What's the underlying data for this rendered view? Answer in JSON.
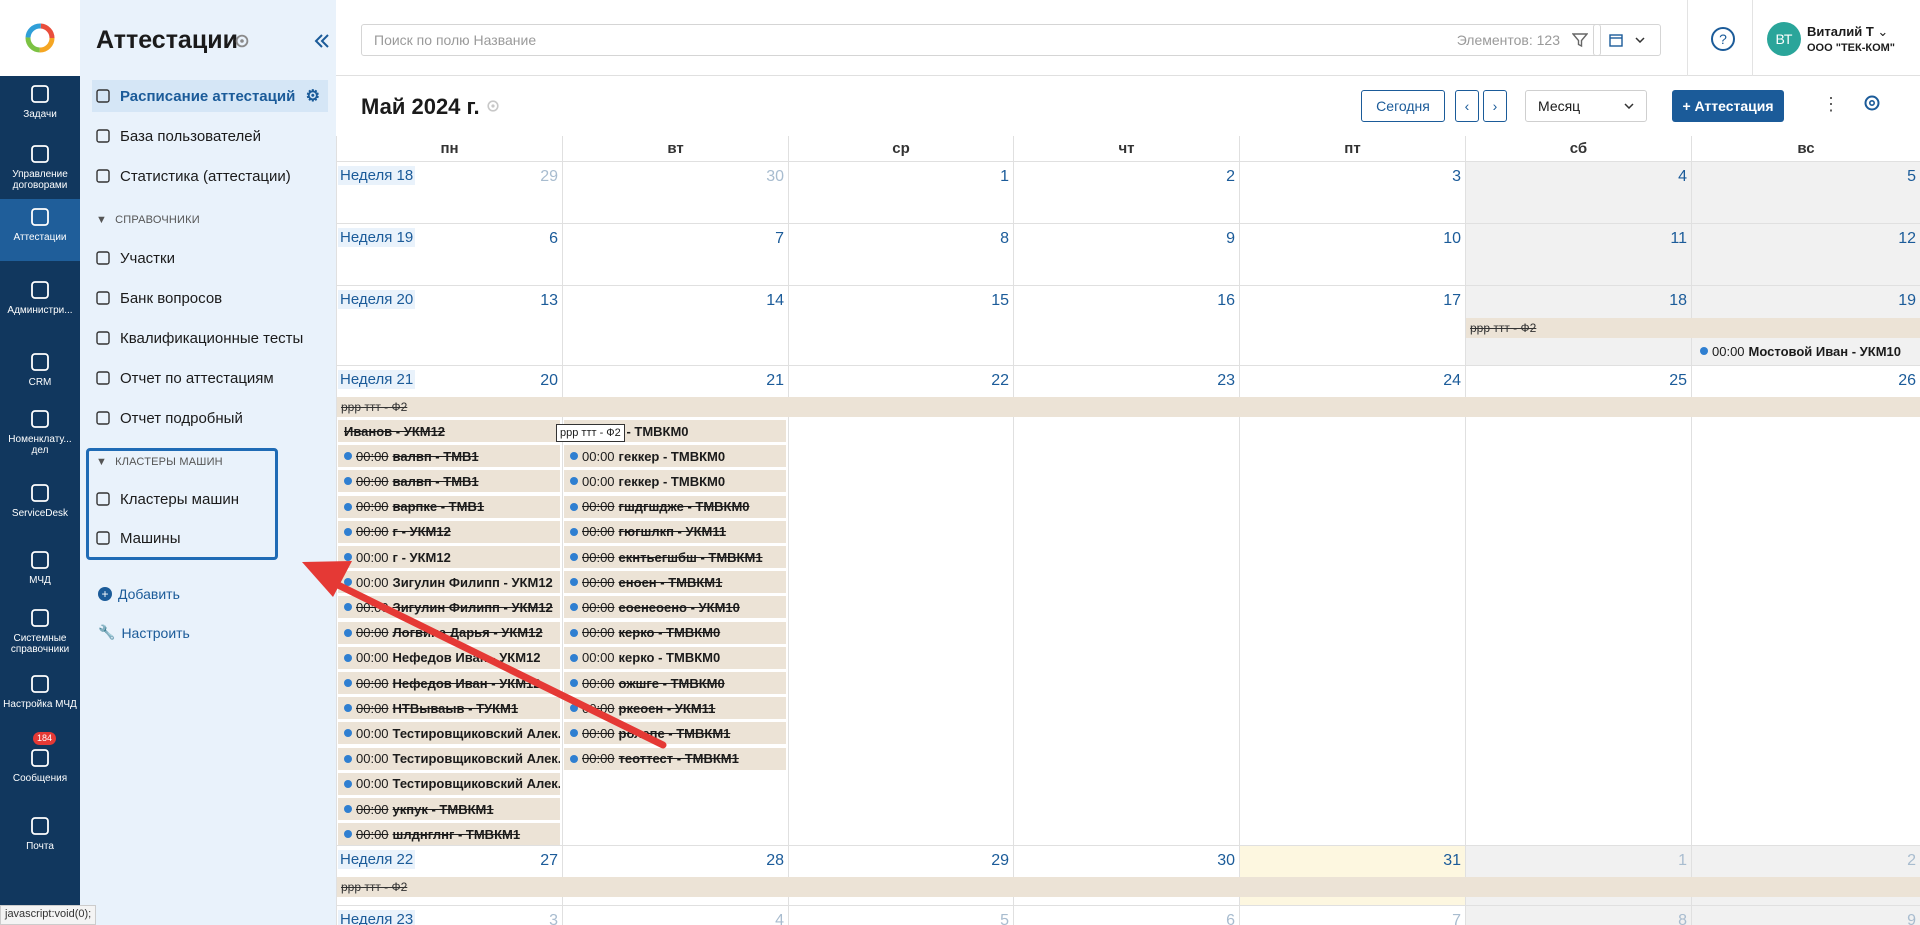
{
  "rail": {
    "items": [
      {
        "label": "Задачи",
        "icon": "arrow-up-icon"
      },
      {
        "label": "Управление договорами",
        "icon": "briefcase-icon"
      },
      {
        "label": "Аттестации",
        "icon": "graduation-cap-icon"
      },
      {
        "label": "Администри...",
        "icon": "gear-icon"
      },
      {
        "label": "CRM",
        "icon": "crm-icon"
      },
      {
        "label": "Номенклату... дел",
        "icon": "book-icon"
      },
      {
        "label": "ServiceDesk",
        "icon": "support-agent-icon"
      },
      {
        "label": "МЧД",
        "icon": "archive-box-icon"
      },
      {
        "label": "Системные справочники",
        "icon": "book-icon"
      },
      {
        "label": "Настройка МЧД",
        "icon": "gear-icon"
      },
      {
        "label": "Сообщения",
        "icon": "envelope-icon",
        "badge": "184"
      },
      {
        "label": "Почта",
        "icon": "at-icon"
      }
    ]
  },
  "sidebar": {
    "title": "Аттестации",
    "items": [
      {
        "label": "Расписание аттестаций",
        "icon": "graduation-cap-icon"
      },
      {
        "label": "База пользователей",
        "icon": "user-icon"
      },
      {
        "label": "Статистика (аттестации)",
        "icon": "bar-chart-icon"
      }
    ],
    "section1": "СПРАВОЧНИКИ",
    "refs": [
      {
        "label": "Участки",
        "icon": "area-icon"
      },
      {
        "label": "Банк вопросов",
        "icon": "clipboard-icon"
      },
      {
        "label": "Квалификационные тесты",
        "icon": "checklist-icon"
      },
      {
        "label": "Отчет по аттестациям",
        "icon": "report-icon"
      },
      {
        "label": "Отчет подробный",
        "icon": "cloud-icon"
      }
    ],
    "section2": "КЛАСТЕРЫ МАШИН",
    "clusters": [
      {
        "label": "Кластеры машин",
        "icon": "database-icon"
      },
      {
        "label": "Машины",
        "icon": "machine-icon"
      }
    ],
    "add_label": "Добавить",
    "configure_label": "Настроить"
  },
  "topbar": {
    "search_placeholder": "Поиск по полю Название",
    "count_label": "Элементов: 123",
    "user_initials": "ВТ",
    "user_name": "Виталий Т",
    "user_org": "ООО \"ТЕК-КОМ\""
  },
  "calendar": {
    "month_title": "Май 2024 г.",
    "today_label": "Сегодня",
    "view_label": "Месяц",
    "add_label": "+ Аттестация",
    "day_names": [
      "пн",
      "вт",
      "ср",
      "чт",
      "пт",
      "сб",
      "вс"
    ],
    "weeks": [
      {
        "label": "Неделя 18",
        "days": [
          "29",
          "30",
          "1",
          "2",
          "3",
          "4",
          "5"
        ]
      },
      {
        "label": "Неделя 19",
        "days": [
          "6",
          "7",
          "8",
          "9",
          "10",
          "11",
          "12"
        ]
      },
      {
        "label": "Неделя 20",
        "days": [
          "13",
          "14",
          "15",
          "16",
          "17",
          "18",
          "19"
        ]
      },
      {
        "label": "Неделя 21",
        "days": [
          "20",
          "21",
          "22",
          "23",
          "24",
          "25",
          "26"
        ]
      },
      {
        "label": "Неделя 22",
        "days": [
          "27",
          "28",
          "29",
          "30",
          "31",
          "1",
          "2"
        ]
      },
      {
        "label": "Неделя 23",
        "days": [
          "3",
          "4",
          "5",
          "6",
          "7",
          "8",
          "9"
        ]
      }
    ],
    "span_event": "ррр ттт - Ф2",
    "week20_sun_event": {
      "time": "00:00",
      "name": "Мостовой Иван - УКМ10"
    },
    "mon_events": [
      {
        "time": "",
        "name": "Иванов - УКМ12",
        "struck": true,
        "dot": false
      },
      {
        "time": "00:00",
        "name": "валвп - ТМВ1",
        "struck": true
      },
      {
        "time": "00:00",
        "name": "валвп - ТМВ1",
        "struck": true
      },
      {
        "time": "00:00",
        "name": "варпке - ТМВ1",
        "struck": true
      },
      {
        "time": "00:00",
        "name": "г - УКМ12",
        "struck": true
      },
      {
        "time": "00:00",
        "name": "г - УКМ12",
        "struck": false
      },
      {
        "time": "00:00",
        "name": "Зигулин Филипп - УКМ12",
        "struck": false
      },
      {
        "time": "00:00",
        "name": "Зигулин Филипп - УКМ12",
        "struck": true
      },
      {
        "time": "00:00",
        "name": "Логвина Дарья - УКМ12",
        "struck": true
      },
      {
        "time": "00:00",
        "name": "Нефедов Иван - УКМ12",
        "struck": false
      },
      {
        "time": "00:00",
        "name": "Нефедов Иван - УКМ12",
        "struck": true
      },
      {
        "time": "00:00",
        "name": "НТВываыв - ТУКМ1",
        "struck": true
      },
      {
        "time": "00:00",
        "name": "Тестировщиковский Алек...",
        "struck": false
      },
      {
        "time": "00:00",
        "name": "Тестировщиковский Алек...",
        "struck": false
      },
      {
        "time": "00:00",
        "name": "Тестировщиковский Алек...",
        "struck": false
      },
      {
        "time": "00:00",
        "name": "укпук - ТМВКМ1",
        "struck": true
      },
      {
        "time": "00:00",
        "name": "шлднглнг - ТМВКМ1",
        "struck": true
      }
    ],
    "tue_events": [
      {
        "time": "",
        "name": "геккер - ТМВКМ0",
        "struck": false
      },
      {
        "time": "00:00",
        "name": "геккер - ТМВКМ0",
        "struck": false
      },
      {
        "time": "00:00",
        "name": "геккер - ТМВКМ0",
        "struck": false
      },
      {
        "time": "00:00",
        "name": "гшдгшдже - ТМВКМ0",
        "struck": true
      },
      {
        "time": "00:00",
        "name": "гюгшлкп - УКМ11",
        "struck": true
      },
      {
        "time": "00:00",
        "name": "екнтьегшбш - ТМВКМ1",
        "struck": true
      },
      {
        "time": "00:00",
        "name": "еноен - ТМВКМ1",
        "struck": true
      },
      {
        "time": "00:00",
        "name": "еоенеоено - УКМ10",
        "struck": true
      },
      {
        "time": "00:00",
        "name": "керко - ТМВКМ0",
        "struck": true
      },
      {
        "time": "00:00",
        "name": "керко - ТМВКМ0",
        "struck": false
      },
      {
        "time": "00:00",
        "name": "ожшге - ТМВКМ0",
        "struck": true
      },
      {
        "time": "00:00",
        "name": "ркеоен - УКМ11",
        "struck": true
      },
      {
        "time": "00:00",
        "name": "ролапе - ТМВКМ1",
        "struck": true
      },
      {
        "time": "00:00",
        "name": "теоттест - ТМВКМ1",
        "struck": true
      }
    ],
    "tooltip": "ррр ттт - Ф2"
  },
  "status_bar": "javascript:void(0);"
}
